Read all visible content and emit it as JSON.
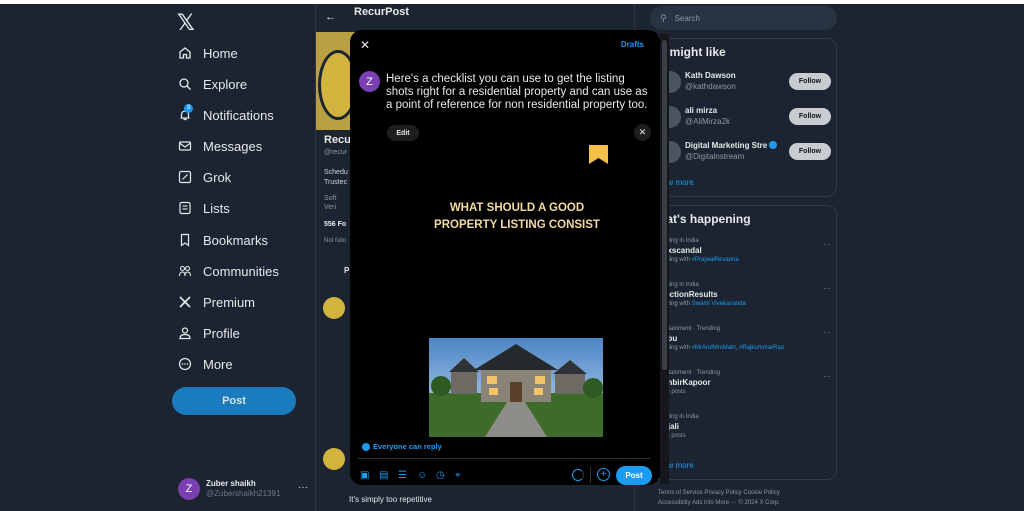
{
  "nav": {
    "items": [
      {
        "label": "Home",
        "icon": "home-icon"
      },
      {
        "label": "Explore",
        "icon": "search-icon"
      },
      {
        "label": "Notifications",
        "icon": "bell-icon"
      },
      {
        "label": "Messages",
        "icon": "envelope-icon"
      },
      {
        "label": "Grok",
        "icon": "grok-icon"
      },
      {
        "label": "Lists",
        "icon": "list-icon"
      },
      {
        "label": "Bookmarks",
        "icon": "bookmark-icon"
      },
      {
        "label": "Communities",
        "icon": "people-icon"
      },
      {
        "label": "Premium",
        "icon": "x-logo-icon"
      },
      {
        "label": "Profile",
        "icon": "person-icon"
      },
      {
        "label": "More",
        "icon": "more-circle-icon"
      }
    ],
    "notification_badge": "3",
    "post_label": "Post",
    "account": {
      "initial": "Z",
      "name": "Zuber shaikh",
      "handle": "@Zubershaikh21391"
    }
  },
  "profile": {
    "header_title": "RecurPost",
    "name": "Recu",
    "handle": "@recur",
    "bio_line1": "Schedu",
    "bio_line2": "Trustec",
    "meta_line1": "Soft",
    "meta_line2": "Veri",
    "followers": "556 Fo",
    "not_followed": "Not follo",
    "tab": "P",
    "feed_text": "It's simply too repetitive"
  },
  "right": {
    "search_placeholder": "Search",
    "who_to_follow": {
      "title": "u might like",
      "people": [
        {
          "name": "Kath Dawson",
          "handle": "@kathdawson",
          "follow": "Follow"
        },
        {
          "name": "ali mirza",
          "handle": "@AliMirza2k",
          "follow": "Follow"
        },
        {
          "name": "Digital Marketing Stre",
          "handle": "@Digitalnstream",
          "follow": "Follow"
        }
      ],
      "show_more": "ow more"
    },
    "happening": {
      "title": "hat's happening",
      "trends": [
        {
          "context": "nding in India",
          "topic": "exscandal",
          "sub": "nding with ",
          "link": "#PrajwalRevanna"
        },
        {
          "context": "nding in India",
          "topic": "lectionResults",
          "sub": "nding with ",
          "link": "Swami Vivekananda"
        },
        {
          "context": "ertainment · Trending",
          "topic": "abu",
          "sub": "nding with ",
          "link": "#MrAndMrsMahi, #RajkummarRao"
        },
        {
          "context": "ertainment · Trending",
          "topic": "anbirKapoor",
          "sub": "53 posts",
          "link": ""
        },
        {
          "context": "nding in India",
          "topic": "njali",
          "sub": "33 posts",
          "link": ""
        }
      ],
      "show_more": "ow more"
    },
    "footer_line1": "Terms of Service  Privacy Policy  Cookie Policy",
    "footer_line2": "Accessibility  Ads info  More ···  © 2024 X Corp."
  },
  "composer": {
    "drafts": "Drafts",
    "avatar_initial": "Z",
    "text": "Here's a checklist you can use to get the listing shots right for a residential property and can use as a point of reference for non residential property too.",
    "edit_label": "Edit",
    "media_headline_line1": "WHAT SHOULD A GOOD",
    "media_headline_line2": "PROPERTY LISTING CONSIST",
    "reply_setting": "Everyone can reply",
    "post_label": "Post",
    "tools": [
      "image-icon",
      "gif-icon",
      "poll-icon",
      "emoji-icon",
      "schedule-icon",
      "location-icon"
    ]
  },
  "colors": {
    "accent": "#1d9bf0",
    "background": "#1b2430",
    "modal": "#000000",
    "headline": "#f3d9a0",
    "bookmark": "#f5c04b"
  }
}
